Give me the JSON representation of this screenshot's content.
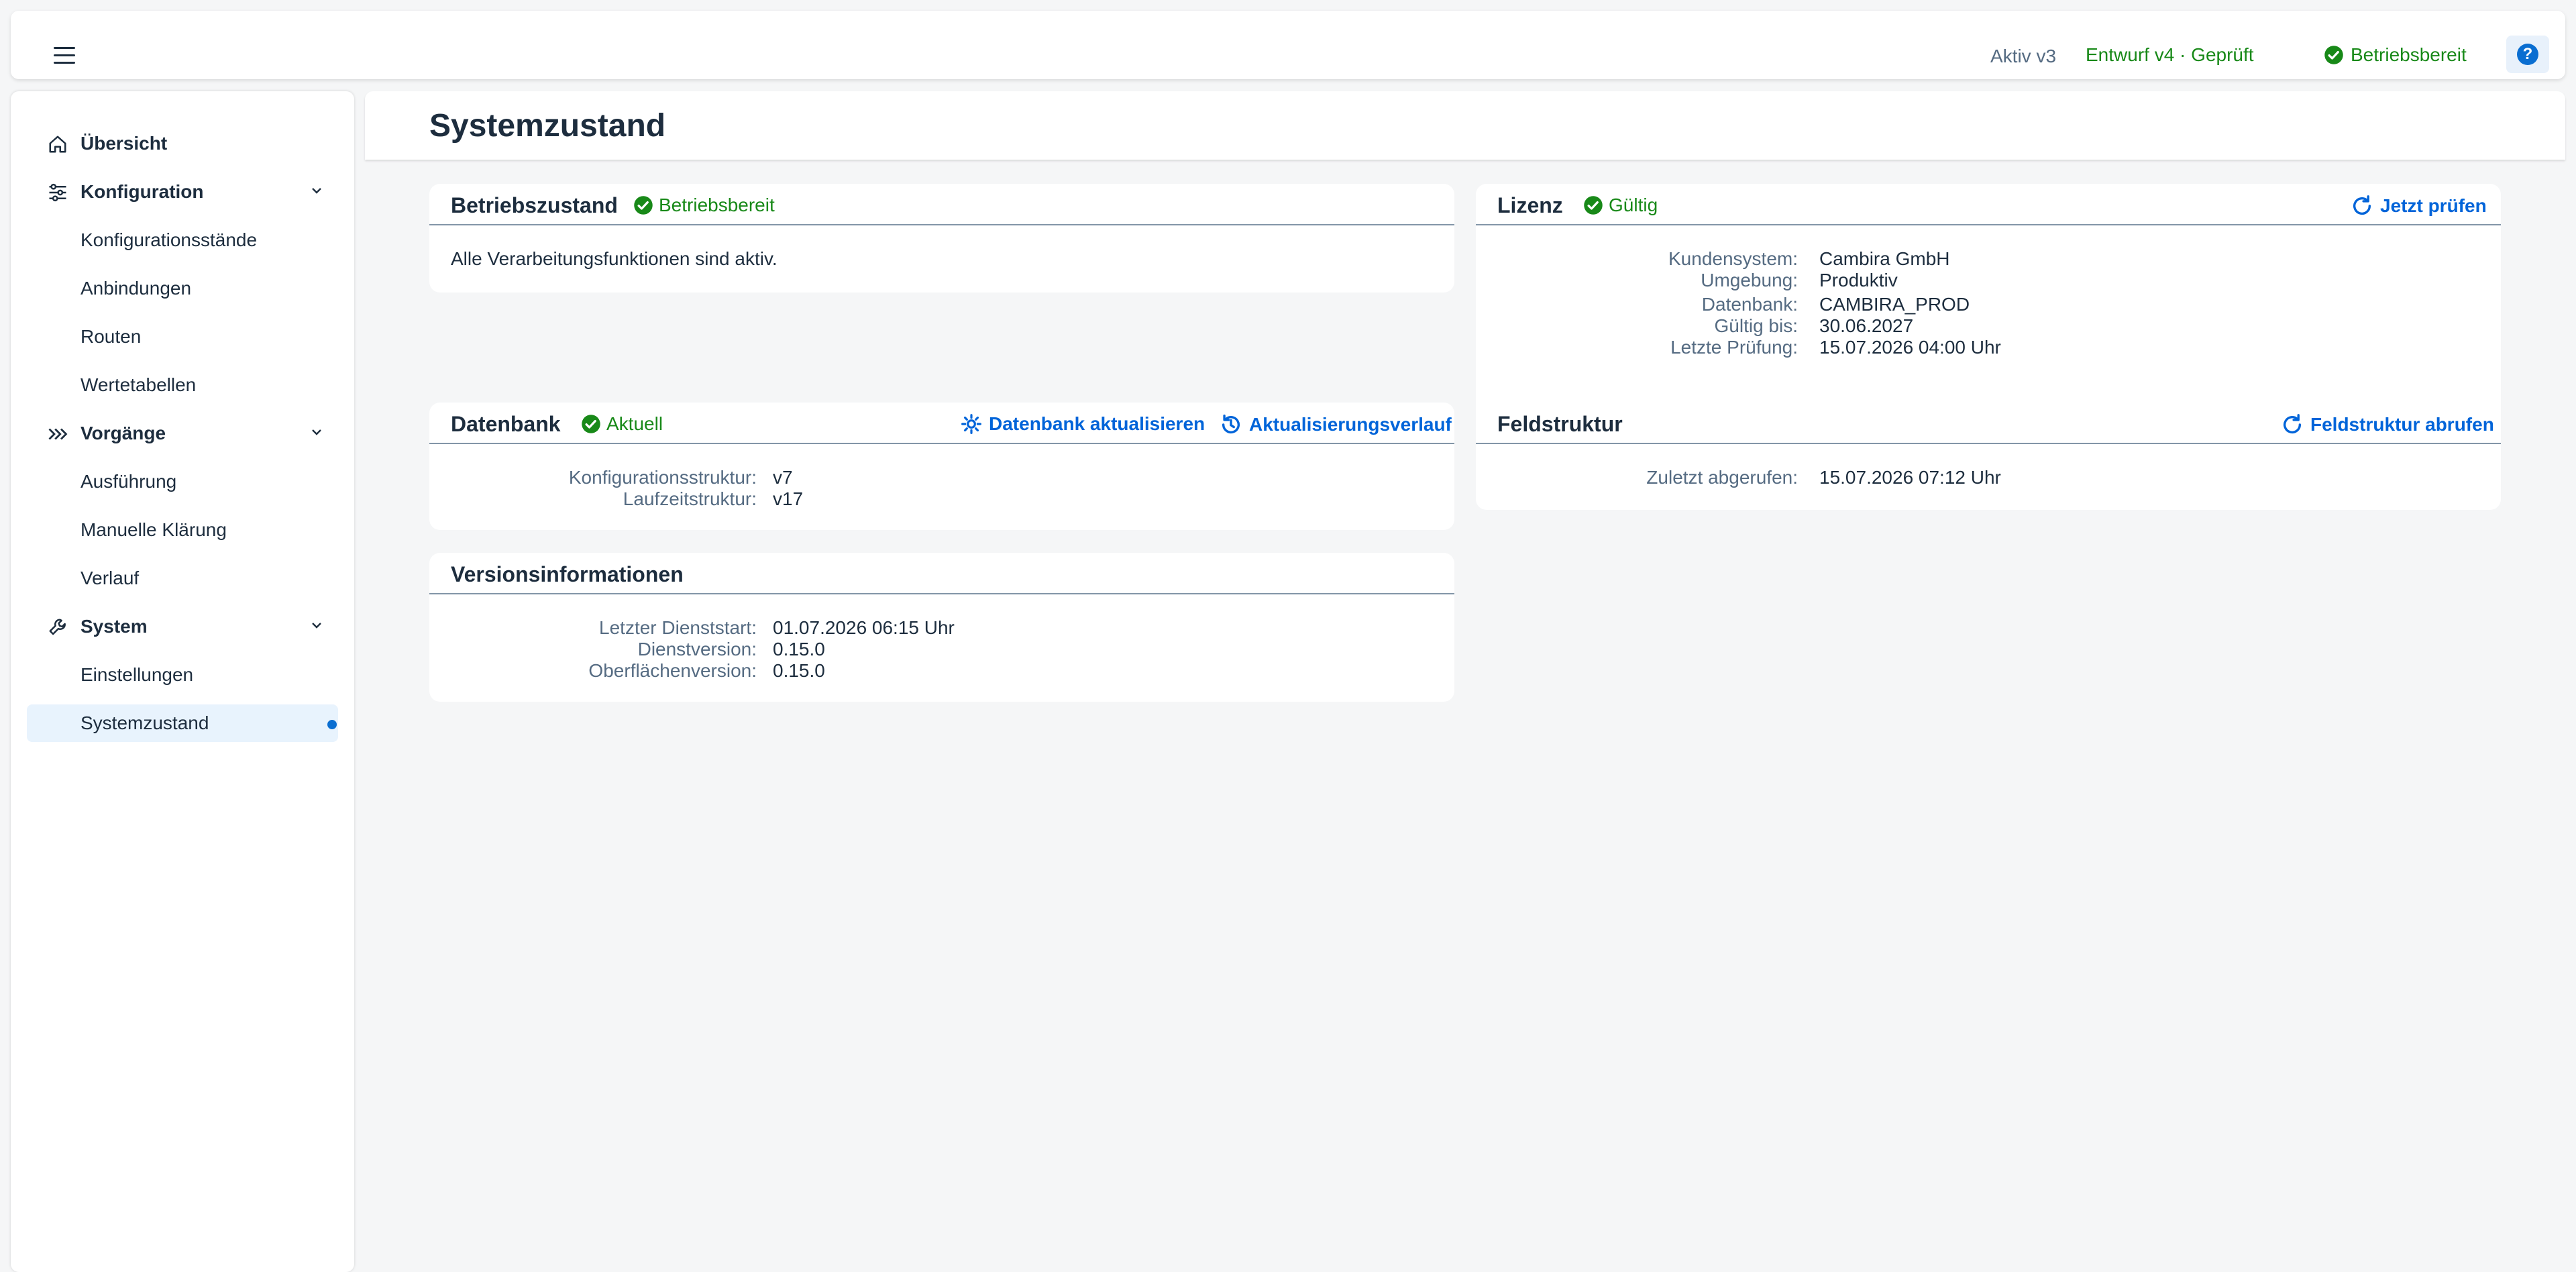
{
  "shellbar": {
    "aktiv": "Aktiv v3",
    "entwurf": "Entwurf v4 · Geprüft",
    "status": "Betriebsbereit",
    "help": "?"
  },
  "sidebar": {
    "items": [
      {
        "label": "Übersicht",
        "type": "group",
        "icon": "home-icon"
      },
      {
        "label": "Konfiguration",
        "type": "group",
        "icon": "sliders-icon"
      },
      {
        "label": "Konfigurationsstände",
        "type": "child"
      },
      {
        "label": "Anbindungen",
        "type": "child"
      },
      {
        "label": "Routen",
        "type": "child"
      },
      {
        "label": "Wertetabellen",
        "type": "child"
      },
      {
        "label": "Vorgänge",
        "type": "group",
        "icon": "process-arrows-icon"
      },
      {
        "label": "Ausführung",
        "type": "child"
      },
      {
        "label": "Manuelle Klärung",
        "type": "child"
      },
      {
        "label": "Verlauf",
        "type": "child"
      },
      {
        "label": "System",
        "type": "group",
        "icon": "wrench-icon"
      },
      {
        "label": "Einstellungen",
        "type": "child"
      },
      {
        "label": "Systemzustand",
        "type": "child",
        "selected": true
      }
    ]
  },
  "page": {
    "title": "Systemzustand"
  },
  "betriebszustand": {
    "title": "Betriebszustand",
    "status": "Betriebsbereit",
    "text": "Alle Verarbeitungsfunktionen sind aktiv."
  },
  "lizenz": {
    "title": "Lizenz",
    "status": "Gültig",
    "action": "Jetzt prüfen",
    "rows": [
      {
        "k": "Kundensystem:",
        "v": "Cambira GmbH"
      },
      {
        "k": "Umgebung:",
        "v": "Produktiv"
      },
      {
        "k": "Datenbank:",
        "v": "CAMBIRA_PROD"
      },
      {
        "k": "Gültig bis:",
        "v": "30.06.2027"
      },
      {
        "k": "Letzte Prüfung:",
        "v": "15.07.2026 04:00 Uhr"
      }
    ]
  },
  "datenbank": {
    "title": "Datenbank",
    "status": "Aktuell",
    "action_update": "Datenbank aktualisieren",
    "action_history": "Aktualisierungsverlauf",
    "rows": [
      {
        "k": "Konfigurationsstruktur:",
        "v": "v7"
      },
      {
        "k": "Laufzeitstruktur:",
        "v": "v17"
      }
    ]
  },
  "feldstruktur": {
    "title": "Feldstruktur",
    "action": "Feldstruktur abrufen",
    "rows": [
      {
        "k": "Zuletzt abgerufen:",
        "v": "15.07.2026 07:12 Uhr"
      }
    ]
  },
  "version": {
    "title": "Versionsinformationen",
    "rows": [
      {
        "k": "Letzter Dienststart:",
        "v": "01.07.2026 06:15 Uhr"
      },
      {
        "k": "Dienstversion:",
        "v": "0.15.0"
      },
      {
        "k": "Oberflächenversion:",
        "v": "0.15.0"
      }
    ]
  },
  "colors": {
    "success": "#188918",
    "link": "#0064d9",
    "selected": "#e8f3fd",
    "text": "#1d2d3e"
  }
}
